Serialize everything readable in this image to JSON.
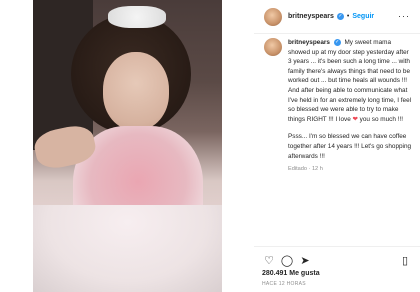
{
  "header": {
    "username": "britneyspears",
    "verified_icon": "verified-badge-icon",
    "separator": "•",
    "follow_label": "Seguir",
    "more_label": "···"
  },
  "caption": {
    "username": "britneyspears",
    "para1_a": "My sweet mama showed up at my door step yesterday after 3 years ... it's been such a long time ... with family there's always things that need to be worked out ... but time heals all wounds !!! And after being able to communicate what I've held in for an extremely long time, I feel so blessed we were able to try to make things RIGHT !!! I love",
    "heart": "❤",
    "para1_b": "you so much !!!",
    "para2": "Psss... I'm so blessed we can have coffee together after 14 years !!! Let's go shopping afterwards !!!",
    "meta": "Editado · 12 h"
  },
  "footer": {
    "like_icon": "heart-icon",
    "comment_icon": "comment-icon",
    "share_icon": "share-icon",
    "save_icon": "bookmark-icon",
    "like_glyph": "♡",
    "comment_glyph": "◯",
    "share_glyph": "➤",
    "save_glyph": "▯",
    "likes": "280.491 Me gusta",
    "date": "HACE 12 HORAS"
  }
}
